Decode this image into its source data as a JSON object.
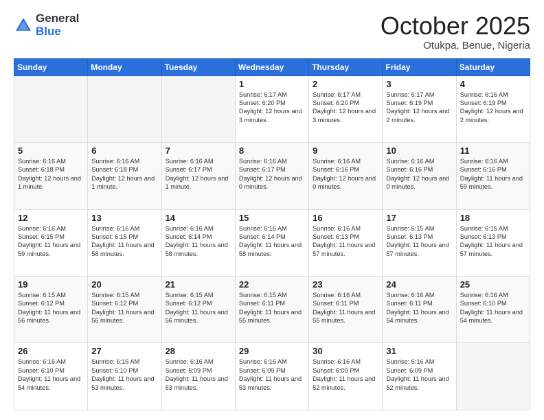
{
  "header": {
    "logo_general": "General",
    "logo_blue": "Blue",
    "title": "October 2025",
    "location": "Otukpa, Benue, Nigeria"
  },
  "days_of_week": [
    "Sunday",
    "Monday",
    "Tuesday",
    "Wednesday",
    "Thursday",
    "Friday",
    "Saturday"
  ],
  "weeks": [
    [
      {
        "day": "",
        "info": ""
      },
      {
        "day": "",
        "info": ""
      },
      {
        "day": "",
        "info": ""
      },
      {
        "day": "1",
        "info": "Sunrise: 6:17 AM\nSunset: 6:20 PM\nDaylight: 12 hours\nand 3 minutes."
      },
      {
        "day": "2",
        "info": "Sunrise: 6:17 AM\nSunset: 6:20 PM\nDaylight: 12 hours\nand 3 minutes."
      },
      {
        "day": "3",
        "info": "Sunrise: 6:17 AM\nSunset: 6:19 PM\nDaylight: 12 hours\nand 2 minutes."
      },
      {
        "day": "4",
        "info": "Sunrise: 6:16 AM\nSunset: 6:19 PM\nDaylight: 12 hours\nand 2 minutes."
      }
    ],
    [
      {
        "day": "5",
        "info": "Sunrise: 6:16 AM\nSunset: 6:18 PM\nDaylight: 12 hours\nand 1 minute."
      },
      {
        "day": "6",
        "info": "Sunrise: 6:16 AM\nSunset: 6:18 PM\nDaylight: 12 hours\nand 1 minute."
      },
      {
        "day": "7",
        "info": "Sunrise: 6:16 AM\nSunset: 6:17 PM\nDaylight: 12 hours\nand 1 minute."
      },
      {
        "day": "8",
        "info": "Sunrise: 6:16 AM\nSunset: 6:17 PM\nDaylight: 12 hours\nand 0 minutes."
      },
      {
        "day": "9",
        "info": "Sunrise: 6:16 AM\nSunset: 6:16 PM\nDaylight: 12 hours\nand 0 minutes."
      },
      {
        "day": "10",
        "info": "Sunrise: 6:16 AM\nSunset: 6:16 PM\nDaylight: 12 hours\nand 0 minutes."
      },
      {
        "day": "11",
        "info": "Sunrise: 6:16 AM\nSunset: 6:16 PM\nDaylight: 11 hours\nand 59 minutes."
      }
    ],
    [
      {
        "day": "12",
        "info": "Sunrise: 6:16 AM\nSunset: 6:15 PM\nDaylight: 11 hours\nand 59 minutes."
      },
      {
        "day": "13",
        "info": "Sunrise: 6:16 AM\nSunset: 6:15 PM\nDaylight: 11 hours\nand 58 minutes."
      },
      {
        "day": "14",
        "info": "Sunrise: 6:16 AM\nSunset: 6:14 PM\nDaylight: 11 hours\nand 58 minutes."
      },
      {
        "day": "15",
        "info": "Sunrise: 6:16 AM\nSunset: 6:14 PM\nDaylight: 11 hours\nand 58 minutes."
      },
      {
        "day": "16",
        "info": "Sunrise: 6:16 AM\nSunset: 6:13 PM\nDaylight: 11 hours\nand 57 minutes."
      },
      {
        "day": "17",
        "info": "Sunrise: 6:15 AM\nSunset: 6:13 PM\nDaylight: 11 hours\nand 57 minutes."
      },
      {
        "day": "18",
        "info": "Sunrise: 6:15 AM\nSunset: 6:13 PM\nDaylight: 11 hours\nand 57 minutes."
      }
    ],
    [
      {
        "day": "19",
        "info": "Sunrise: 6:15 AM\nSunset: 6:12 PM\nDaylight: 11 hours\nand 56 minutes."
      },
      {
        "day": "20",
        "info": "Sunrise: 6:15 AM\nSunset: 6:12 PM\nDaylight: 11 hours\nand 56 minutes."
      },
      {
        "day": "21",
        "info": "Sunrise: 6:15 AM\nSunset: 6:12 PM\nDaylight: 11 hours\nand 56 minutes."
      },
      {
        "day": "22",
        "info": "Sunrise: 6:15 AM\nSunset: 6:11 PM\nDaylight: 11 hours\nand 55 minutes."
      },
      {
        "day": "23",
        "info": "Sunrise: 6:16 AM\nSunset: 6:11 PM\nDaylight: 11 hours\nand 55 minutes."
      },
      {
        "day": "24",
        "info": "Sunrise: 6:16 AM\nSunset: 6:11 PM\nDaylight: 11 hours\nand 54 minutes."
      },
      {
        "day": "25",
        "info": "Sunrise: 6:16 AM\nSunset: 6:10 PM\nDaylight: 11 hours\nand 54 minutes."
      }
    ],
    [
      {
        "day": "26",
        "info": "Sunrise: 6:16 AM\nSunset: 6:10 PM\nDaylight: 11 hours\nand 54 minutes."
      },
      {
        "day": "27",
        "info": "Sunrise: 6:16 AM\nSunset: 6:10 PM\nDaylight: 11 hours\nand 53 minutes."
      },
      {
        "day": "28",
        "info": "Sunrise: 6:16 AM\nSunset: 6:09 PM\nDaylight: 11 hours\nand 53 minutes."
      },
      {
        "day": "29",
        "info": "Sunrise: 6:16 AM\nSunset: 6:09 PM\nDaylight: 11 hours\nand 53 minutes."
      },
      {
        "day": "30",
        "info": "Sunrise: 6:16 AM\nSunset: 6:09 PM\nDaylight: 11 hours\nand 52 minutes."
      },
      {
        "day": "31",
        "info": "Sunrise: 6:16 AM\nSunset: 6:09 PM\nDaylight: 11 hours\nand 52 minutes."
      },
      {
        "day": "",
        "info": ""
      }
    ]
  ]
}
